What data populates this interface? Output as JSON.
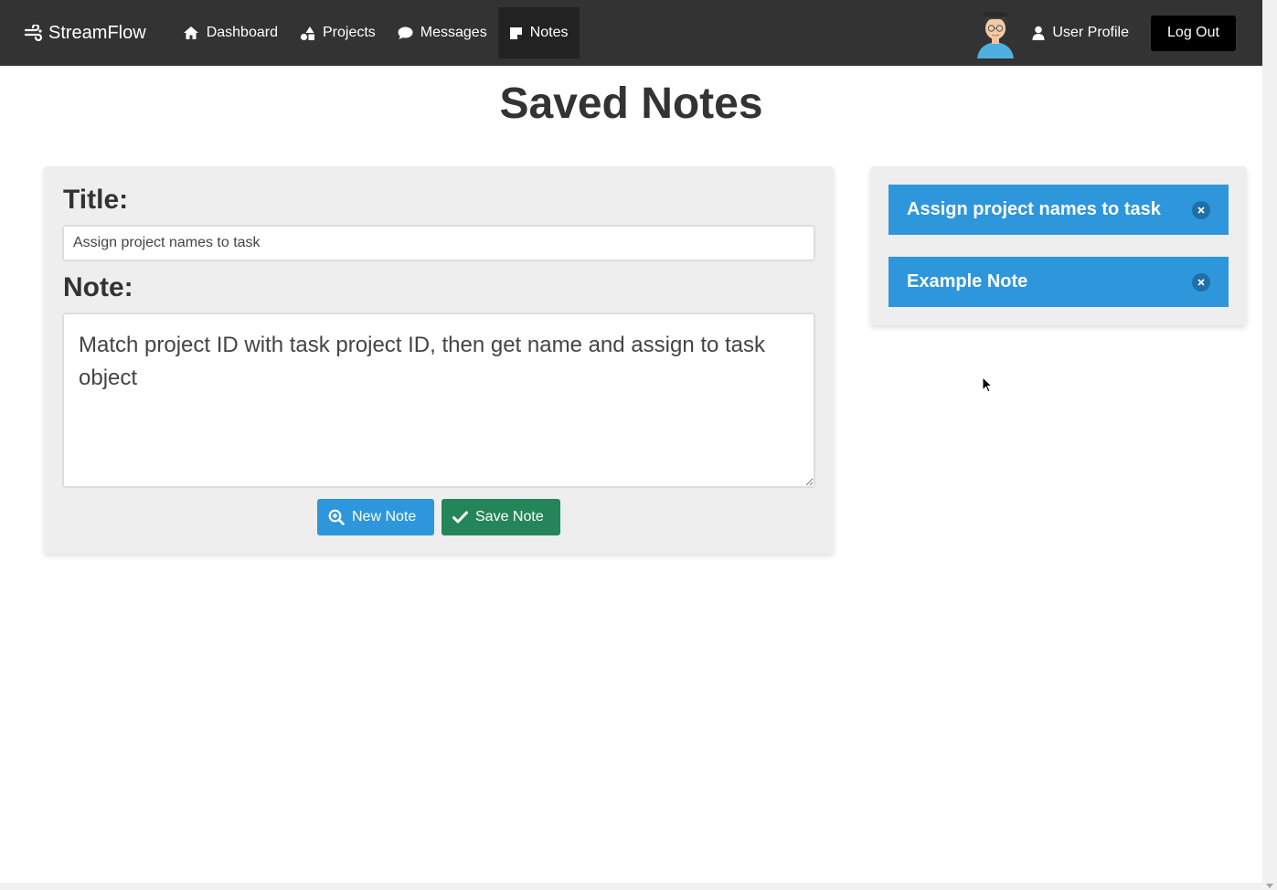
{
  "navbar": {
    "brand": "StreamFlow",
    "links": [
      {
        "label": "Dashboard",
        "icon": "home-icon"
      },
      {
        "label": "Projects",
        "icon": "shapes-icon"
      },
      {
        "label": "Messages",
        "icon": "chat-icon"
      },
      {
        "label": "Notes",
        "icon": "note-icon",
        "active": true
      }
    ],
    "profile_label": "User Profile",
    "logout_label": "Log Out"
  },
  "page": {
    "title": "Saved Notes"
  },
  "editor": {
    "title_label": "Title:",
    "title_value": "Assign project names to task",
    "note_label": "Note:",
    "note_value": "Match project ID with task project ID, then get name and assign to task object",
    "new_button": "New Note",
    "save_button": "Save Note"
  },
  "saved_notes": [
    {
      "title": "Assign project names to task"
    },
    {
      "title": "Example Note"
    }
  ],
  "colors": {
    "navbar_bg": "#333333",
    "active_nav": "#222222",
    "primary_blue": "#2e96db",
    "save_green": "#25855a",
    "card_bg": "#eeeeee"
  }
}
